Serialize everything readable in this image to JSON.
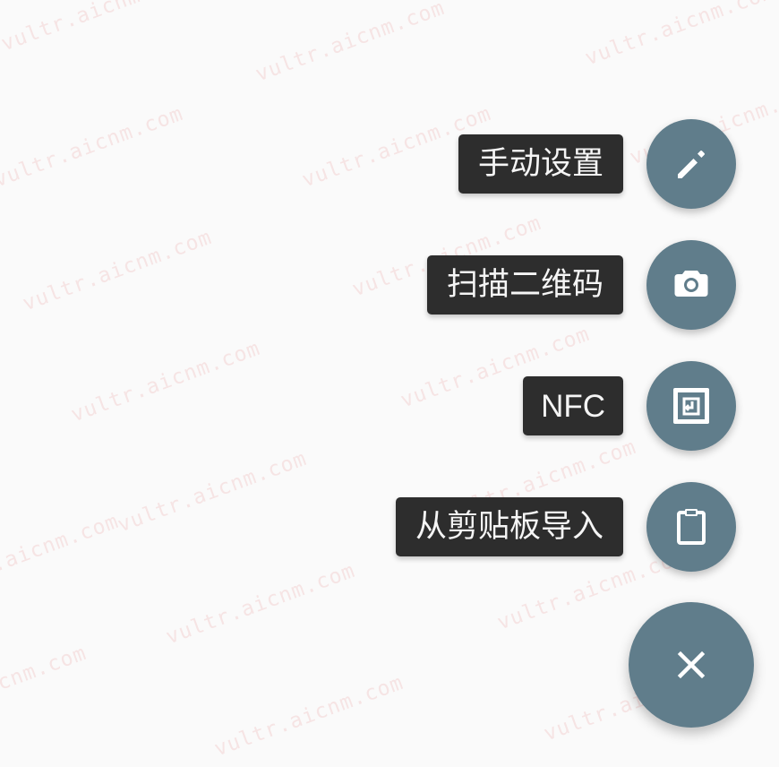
{
  "watermark": {
    "text": "vultr.aicnm.com"
  },
  "fab_menu": {
    "items": [
      {
        "label": "手动设置",
        "icon": "pencil-icon",
        "action_color": "#607d8b"
      },
      {
        "label": "扫描二维码",
        "icon": "camera-icon",
        "action_color": "#607d8b"
      },
      {
        "label": "NFC",
        "icon": "nfc-icon",
        "action_color": "#607d8b"
      },
      {
        "label": "从剪贴板导入",
        "icon": "clipboard-icon",
        "action_color": "#607d8b"
      }
    ],
    "main_button": {
      "icon": "close-icon",
      "color": "#607d8b"
    }
  },
  "colors": {
    "background": "#fafafa",
    "label_background": "#2d2d2d",
    "label_text": "#f5f5f5",
    "fab": "#607d8b",
    "icon": "#ffffff",
    "watermark": "#e89696"
  }
}
